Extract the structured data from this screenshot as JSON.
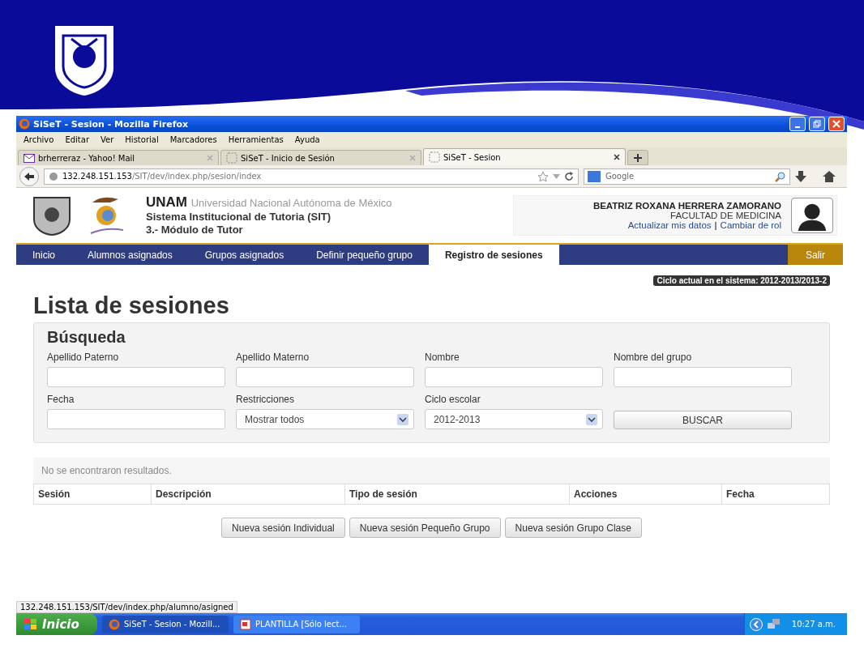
{
  "window": {
    "title": "SiSeT - Sesion - Mozilla Firefox"
  },
  "menu": [
    "Archivo",
    "Editar",
    "Ver",
    "Historial",
    "Marcadores",
    "Herramientas",
    "Ayuda"
  ],
  "tabs": [
    {
      "label": "brherreraz - Yahoo! Mail",
      "selected": false,
      "kind": "mail"
    },
    {
      "label": "SiSeT - Inicio de Sesión",
      "selected": false,
      "kind": "page"
    },
    {
      "label": "SiSeT - Sesion",
      "selected": true,
      "kind": "page"
    }
  ],
  "address": {
    "host": "132.248.151.153",
    "path": "/SIT/dev/index.php/sesion/index"
  },
  "web_search": {
    "placeholder": "Google"
  },
  "site": {
    "brand": "UNAM",
    "brand_full": "Universidad Nacional Autónoma de México",
    "system": "Sistema Institucional de Tutoria (SIT)",
    "module": "3.- Módulo de Tutor"
  },
  "user": {
    "name": "BEATRIZ ROXANA HERRERA ZAMORANO",
    "faculty": "FACULTAD DE MEDICINA",
    "links": [
      "Actualizar mis datos",
      "Cambiar de rol"
    ],
    "link_separator": "|"
  },
  "nav": [
    {
      "label": "Inicio",
      "selected": false
    },
    {
      "label": "Alumnos asignados",
      "selected": false
    },
    {
      "label": "Grupos asignados",
      "selected": false
    },
    {
      "label": "Definir pequeño grupo",
      "selected": false
    },
    {
      "label": "Registro de sesiones",
      "selected": true
    }
  ],
  "logout": "Salir",
  "cycle_badge": "Ciclo actual en el sistema: 2012-2013/2013-2",
  "heading": "Lista de sesiones",
  "search": {
    "title": "Búsqueda",
    "fields": [
      {
        "label": "Apellido Paterno",
        "kind": "text"
      },
      {
        "label": "Apellido Materno",
        "kind": "text"
      },
      {
        "label": "Nombre",
        "kind": "text"
      },
      {
        "label": "Nombre del grupo",
        "kind": "text"
      },
      {
        "label": "Fecha",
        "kind": "text"
      },
      {
        "label": "Restricciones",
        "kind": "select",
        "value": "Mostrar todos"
      },
      {
        "label": "Ciclo escolar",
        "kind": "select",
        "value": "2012-2013"
      },
      {
        "kind": "button",
        "value": "BUSCAR"
      }
    ]
  },
  "results": {
    "message": "No se encontraron resultados.",
    "columns": [
      "Sesión",
      "Descripción",
      "Tipo de sesión",
      "Acciones",
      "Fecha"
    ]
  },
  "actions": [
    "Nueva sesión Individual",
    "Nueva sesión Pequeño Grupo",
    "Nueva sesión Grupo Clase"
  ],
  "status_bar": "132.248.151.153/SIT/dev/index.php/alumno/asigned",
  "taskbar": {
    "start": "Inicio",
    "items": [
      {
        "label": "SiSeT - Sesion - Mozill...",
        "selected": true,
        "kind": "firefox"
      },
      {
        "label": "PLANTILLA [Sólo lect...",
        "selected": false,
        "kind": "slides"
      }
    ],
    "clock": "10:27 a.m."
  }
}
